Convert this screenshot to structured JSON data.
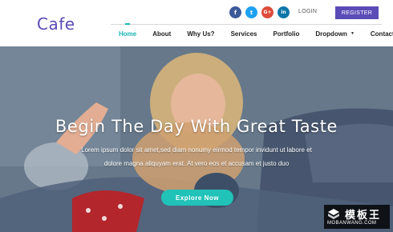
{
  "brand": {
    "logo": "Cafe"
  },
  "header": {
    "socials": [
      {
        "icon": "facebook-icon",
        "glyph": "f",
        "color": "#3b5998"
      },
      {
        "icon": "twitter-icon",
        "glyph": "t",
        "color": "#1da1f2"
      },
      {
        "icon": "google-plus-icon",
        "glyph": "G+",
        "color": "#dd4b39"
      },
      {
        "icon": "linkedin-icon",
        "glyph": "in",
        "color": "#0e76a8"
      }
    ],
    "login_label": "LOGIN",
    "register_label": "REGISTER"
  },
  "nav": {
    "items": [
      {
        "label": "Home",
        "active": true
      },
      {
        "label": "About"
      },
      {
        "label": "Why Us?"
      },
      {
        "label": "Services"
      },
      {
        "label": "Portfolio"
      },
      {
        "label": "Dropdown",
        "has_caret": true
      },
      {
        "label": "Contact"
      }
    ]
  },
  "hero": {
    "title": "Begin The Day With Great Taste",
    "line1": "Lorem ipsum dolor sit amet,sed diam nonumy eirmod tempor invidunt ut labore et",
    "line2": "dolore magna aliquyam erat. At vero eos et accusam et justo duo",
    "button_label": "Explore Now"
  },
  "watermark": {
    "cn": "模板王",
    "en": "MOBANWANG.COM"
  },
  "colors": {
    "brand": "#5b4bb7",
    "accent": "#19b5b3",
    "button": "#21c2b8"
  }
}
